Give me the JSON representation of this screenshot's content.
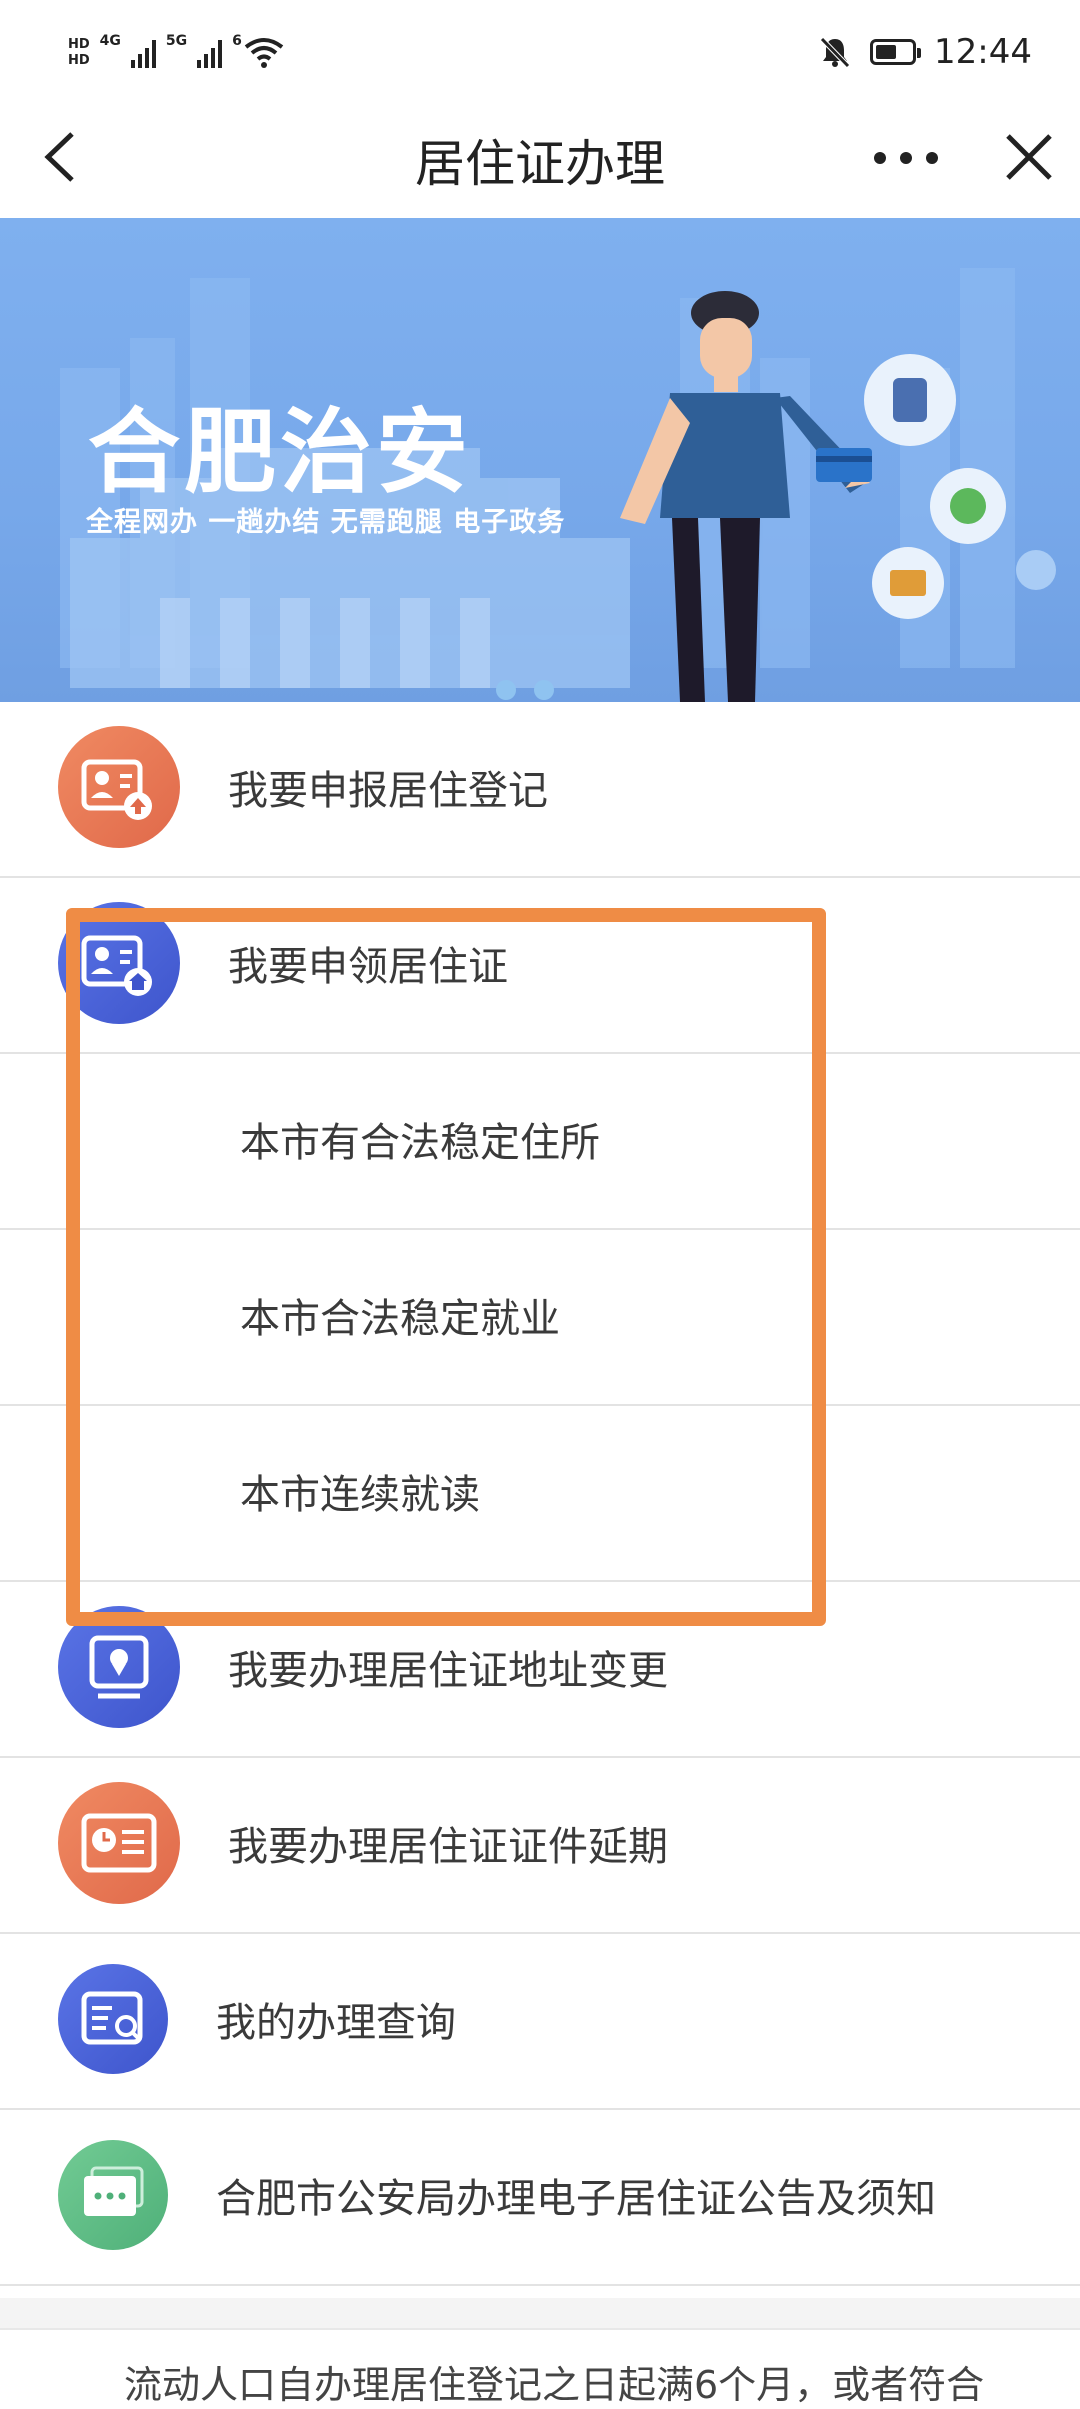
{
  "status_bar": {
    "hd1": "HD",
    "hd2": "HD",
    "net1": "4G",
    "net2": "5G",
    "wifi_num": "6",
    "time": "12:44",
    "icons": [
      "signal-icon",
      "wifi-icon",
      "bell-off-icon",
      "battery-icon"
    ]
  },
  "nav": {
    "title": "居住证办理",
    "back_icon": "chevron-left-icon",
    "more_icon": "more-dots-icon",
    "close_icon": "close-icon"
  },
  "banner": {
    "title": "合肥治安",
    "subtitle": "全程网办  一趟办结  无需跑腿  电子政务"
  },
  "menu": [
    {
      "label": "我要申报居住登记",
      "icon": "id-card-upload-icon",
      "color": "#ea7a55"
    },
    {
      "label": "我要申领居住证",
      "icon": "id-card-home-icon",
      "color": "#4a63d8"
    },
    {
      "label": "本市有合法稳定住所"
    },
    {
      "label": "本市合法稳定就业"
    },
    {
      "label": "本市连续就读"
    },
    {
      "label": "我要办理居住证地址变更",
      "icon": "location-pin-icon",
      "color": "#4a63d8"
    },
    {
      "label": "我要办理居住证证件延期",
      "icon": "clock-card-icon",
      "color": "#ea7a55"
    },
    {
      "label": "我的办理查询",
      "icon": "search-document-icon",
      "color": "#4a63d8"
    },
    {
      "label": "合肥市公安局办理电子居住证公告及须知",
      "icon": "message-icon",
      "color": "#5fbd85"
    }
  ],
  "footer": {
    "text": "流动人口自办理居住登记之日起满6个月，或者符合"
  },
  "colors": {
    "highlight": "#ef8c45",
    "banner": "#7aaaea",
    "blue_icon": "#4a63d8",
    "orange_icon": "#ea7a55",
    "green_icon": "#5fbd85"
  }
}
